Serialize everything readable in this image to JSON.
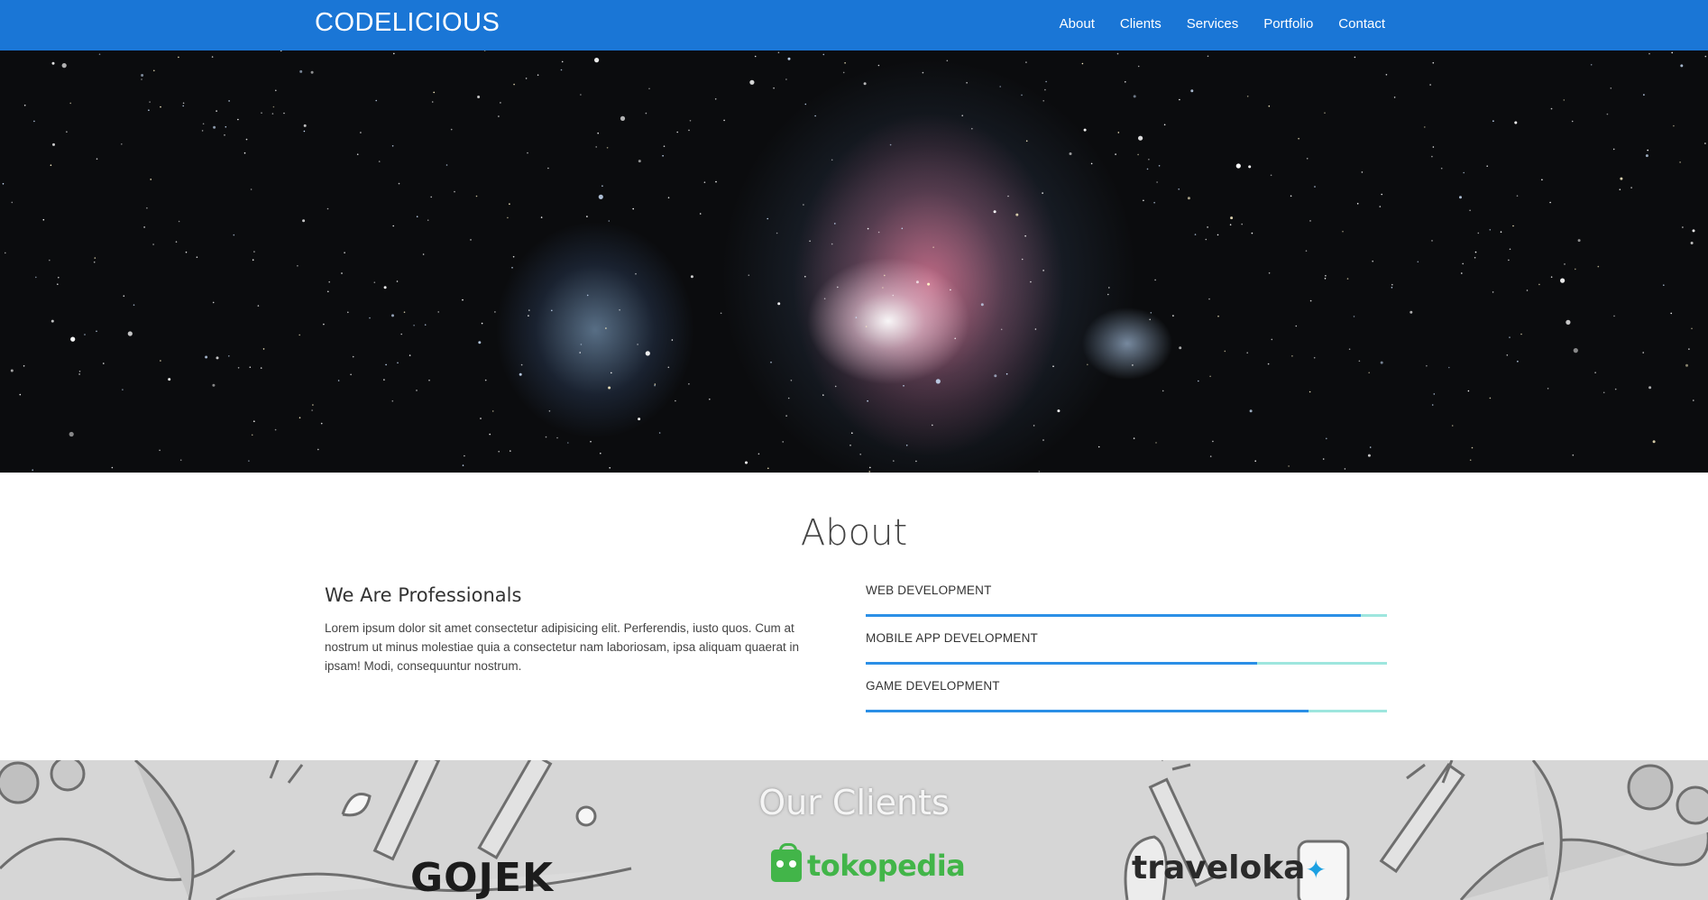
{
  "navbar": {
    "brand": "CODELICIOUS",
    "links": [
      "About",
      "Clients",
      "Services",
      "Portfolio",
      "Contact"
    ],
    "color": "#1a76d6"
  },
  "hero": {
    "image": "orion-nebula-starfield"
  },
  "about": {
    "title": "About",
    "heading": "We Are Professionals",
    "text": "Lorem ipsum dolor sit amet consectetur adipisicing elit. Perferendis, iusto quos. Cum at nostrum ut minus molestiae quia a consectetur nam laboriosam, ipsa aliquam quaerat in ipsam! Modi, consequuntur nostrum.",
    "skills": [
      {
        "label": "WEB DEVELOPMENT",
        "level": 0.95
      },
      {
        "label": "MOBILE APP DEVELOPMENT",
        "level": 0.75
      },
      {
        "label": "GAME DEVELOPMENT",
        "level": 0.85
      }
    ],
    "bar_color": "#2b8fe6",
    "track_color": "#9ee6de"
  },
  "clients": {
    "title": "Our Clients",
    "logos": [
      "GOJEK",
      "tokopedia",
      "traveloka"
    ]
  }
}
